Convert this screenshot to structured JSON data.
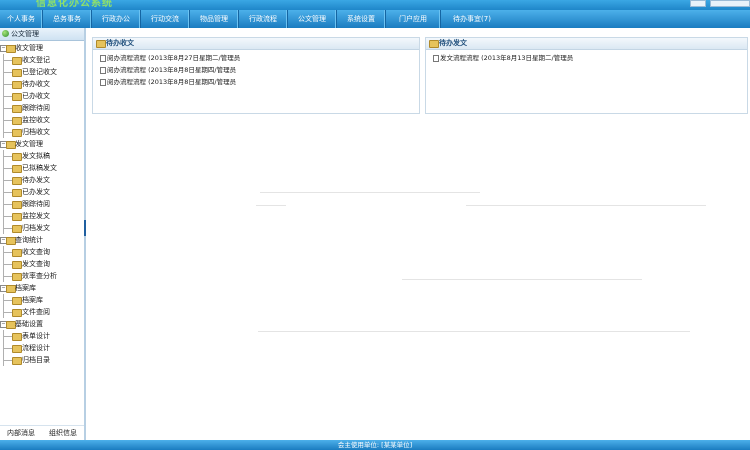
{
  "banner": {
    "title": "信息化办公系统"
  },
  "nav": [
    "个人事务",
    "总务事务",
    "行政办公",
    "行动交流",
    "物品管理",
    "行政流程",
    "公文管理",
    "系统设置",
    "门户应用",
    "待办事宜(7)"
  ],
  "sidebar": {
    "header": "公文管理",
    "groups": [
      {
        "label": "收文管理",
        "items": [
          "收文登记",
          "已登记收文",
          "待办收文",
          "已办收文",
          "跟踪待阅",
          "监控收文",
          "归档收文"
        ]
      },
      {
        "label": "发文管理",
        "items": [
          "发文拟稿",
          "已拟稿发文",
          "待办发文",
          "已办发文",
          "跟踪待阅",
          "监控发文",
          "归档发文"
        ]
      },
      {
        "label": "查询统计",
        "items": [
          "收文查询",
          "发文查询",
          "效率查分析"
        ]
      },
      {
        "label": "档案库",
        "items": [
          "档案库",
          "文件查阅"
        ]
      },
      {
        "label": "基础设置",
        "items": [
          "表单设计",
          "流程设计",
          "归档目录"
        ]
      }
    ],
    "bottom": {
      "left": "内部消息",
      "right": "组织信息"
    }
  },
  "panels": {
    "left": {
      "title": "待办收文",
      "items": [
        "阅办流程流程 (2013年8月27日星期二/管理员",
        "阅办流程流程 (2013年8月8日星期四/管理员",
        "阅办流程流程 (2013年8月8日星期四/管理员"
      ]
    },
    "right": {
      "title": "待办发文",
      "items": [
        "发文流程流程 (2013年8月13日星期二/管理员"
      ]
    }
  },
  "footer": {
    "text": "会主使用单位: [某某单位]"
  }
}
